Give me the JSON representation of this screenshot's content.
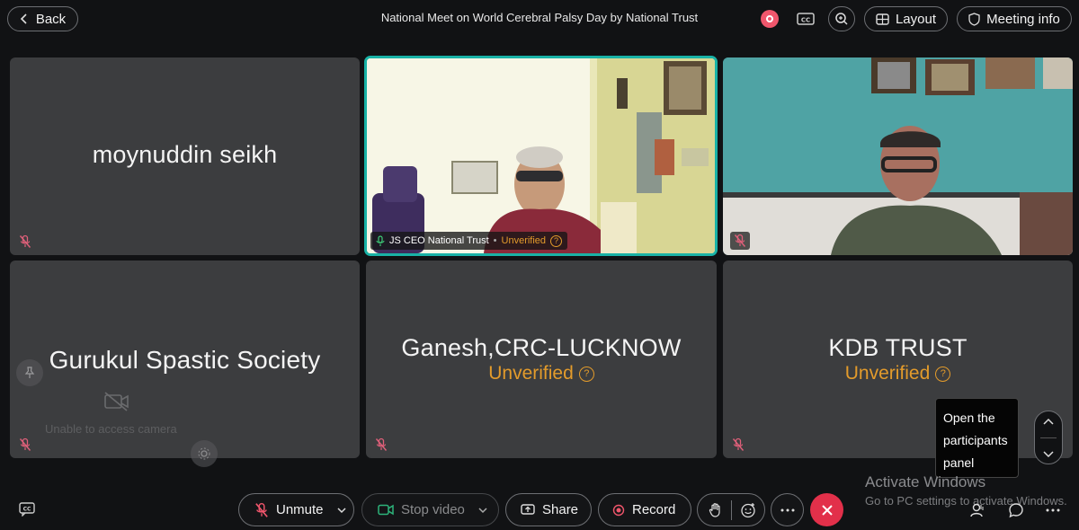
{
  "topbar": {
    "back_label": "Back",
    "meeting_title": "National Meet on World Cerebral Palsy Day by National Trust",
    "layout_label": "Layout",
    "meeting_info_label": "Meeting info"
  },
  "tiles": [
    {
      "name": "moynuddin seikh",
      "unverified": "",
      "muted": true
    },
    {
      "name": "JS CEO National Trust",
      "unverified": "Unverified",
      "video": true,
      "active_speaker": true
    },
    {
      "name": "",
      "unverified": "",
      "video": true,
      "muted": true
    },
    {
      "name": "Gurukul Spastic Society",
      "unverified": "",
      "muted": true,
      "camera_message": "Unable to access camera"
    },
    {
      "name": "Ganesh,CRC-LUCKNOW",
      "unverified": "Unverified",
      "muted": true
    },
    {
      "name": "KDB TRUST",
      "unverified": "Unverified",
      "muted": true
    }
  ],
  "tooltip": {
    "text": "Open the participants panel"
  },
  "watermark": {
    "title": "Activate Windows",
    "subtitle": "Go to PC settings to activate Windows."
  },
  "controls": {
    "unmute_label": "Unmute",
    "stop_video_label": "Stop video",
    "share_label": "Share",
    "record_label": "Record"
  },
  "colors": {
    "accent_teal": "#19b2a6",
    "unverified": "#e39b2b",
    "end_call": "#e2304a",
    "record": "#f0566c"
  }
}
